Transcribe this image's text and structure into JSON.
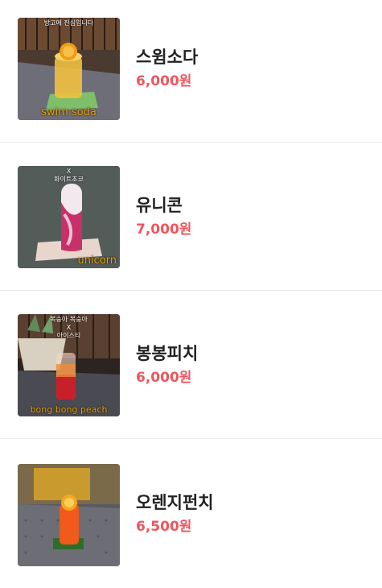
{
  "menu": {
    "items": [
      {
        "name": "스윔소다",
        "price": "6,000원",
        "photo_caption_top": "방고에 진심입니다",
        "photo_caption_bottom": "swim soda"
      },
      {
        "name": "유니콘",
        "price": "7,000원",
        "photo_caption_top": "X\n화이트초코",
        "photo_caption_bottom": "unicorn"
      },
      {
        "name": "봉봉피치",
        "price": "6,000원",
        "photo_caption_top": "복숭아 복숭아\nX\n아이스티",
        "photo_caption_bottom": "bong bong peach"
      },
      {
        "name": "오렌지펀치",
        "price": "6,500원",
        "photo_caption_top": "",
        "photo_caption_bottom": ""
      }
    ]
  },
  "colors": {
    "price": "#f0555c",
    "name": "#222222",
    "divider": "#eaeaea",
    "photo_caption": "#e8a000"
  }
}
